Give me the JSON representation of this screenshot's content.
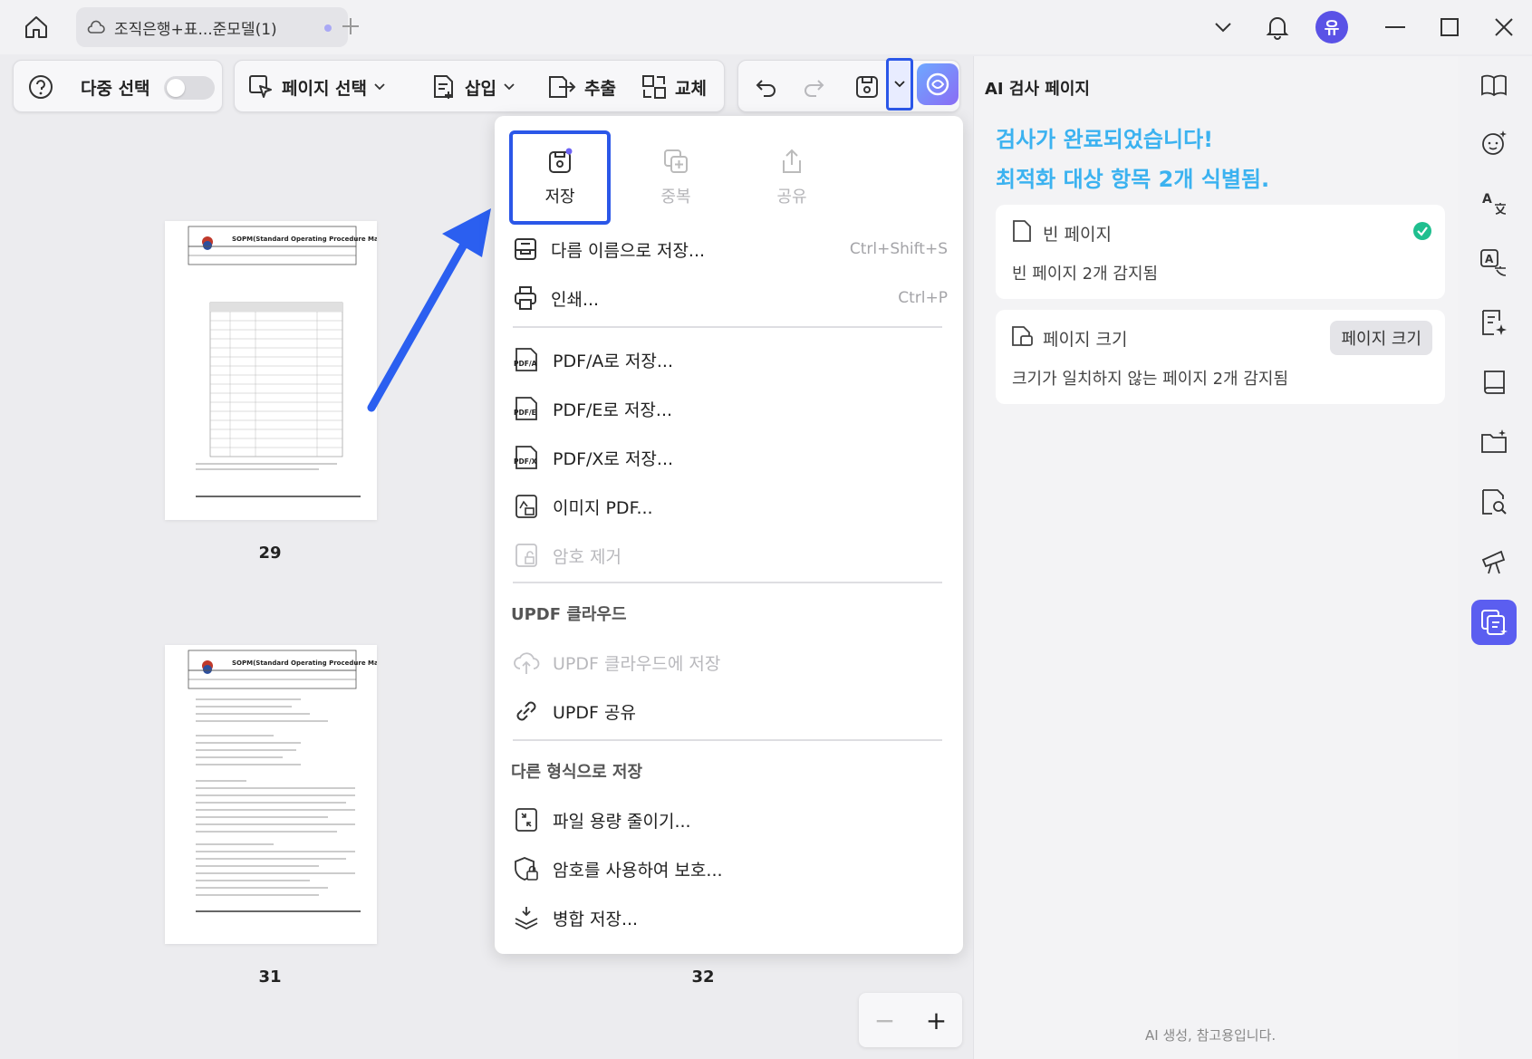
{
  "titlebar": {
    "tab_title": "조직은행+표...준모델(1)",
    "avatar_letter": "유",
    "icons": [
      "home-icon",
      "cloud-icon",
      "plus-icon",
      "chevron-down-icon",
      "bell-icon",
      "minimize-icon",
      "maximize-icon",
      "close-icon"
    ]
  },
  "toolbar": {
    "multi_select_label": "다중 선택",
    "page_select_label": "페이지 선택",
    "insert_label": "삽입",
    "extract_label": "추출",
    "replace_label": "교체"
  },
  "pages": [
    {
      "number": "29",
      "doc_title": "SOPM(Standard Operating Procedure Manual)"
    },
    {
      "number": "31",
      "doc_title": "SOPM(Standard Operating Procedure Manual)"
    },
    {
      "number": "32"
    }
  ],
  "menu": {
    "top_actions": [
      {
        "label": "저장",
        "state": "active"
      },
      {
        "label": "중복",
        "state": "disabled"
      },
      {
        "label": "공유",
        "state": "disabled"
      }
    ],
    "items": {
      "save_as": {
        "label": "다름 이름으로 저장...",
        "shortcut": "Ctrl+Shift+S"
      },
      "print": {
        "label": "인쇄...",
        "shortcut": "Ctrl+P"
      },
      "pdfa": {
        "label": "PDF/A로 저장...",
        "badge": "PDF/A"
      },
      "pdfe": {
        "label": "PDF/E로 저장...",
        "badge": "PDF/E"
      },
      "pdfx": {
        "label": "PDF/X로 저장...",
        "badge": "PDF/X"
      },
      "image_pdf": {
        "label": "이미지 PDF..."
      },
      "remove_password": {
        "label": "암호 제거"
      }
    },
    "cloud_section": "UPDF 클라우드",
    "cloud_items": {
      "save_cloud": {
        "label": "UPDF 클라우드에 저장"
      },
      "share": {
        "label": "UPDF 공유"
      }
    },
    "other_section": "다른 형식으로 저장",
    "other_items": {
      "reduce": {
        "label": "파일 용량 줄이기..."
      },
      "protect": {
        "label": "암호를 사용하여 보호..."
      },
      "flatten": {
        "label": "병합 저장..."
      }
    }
  },
  "panel": {
    "title": "AI 검사 페이지",
    "done_line1": "검사가 완료되었습니다!",
    "done_line2": "최적화 대상 항목 2개 식별됨.",
    "cards": [
      {
        "title": "빈 페이지",
        "desc": "빈 페이지 2개 감지됨"
      },
      {
        "title": "페이지 크기",
        "button": "페이지 크기",
        "desc": "크기가 일치하지 않는 페이지 2개 감지됨"
      }
    ],
    "footer": "AI 생성, 참고용입니다."
  },
  "zoom": {
    "minus": "−",
    "plus": "+"
  },
  "colors": {
    "accent": "#2b57e8",
    "done_text": "#3bb2f0",
    "rail_active": "#5b5ef0",
    "check": "#1fbf8f"
  }
}
